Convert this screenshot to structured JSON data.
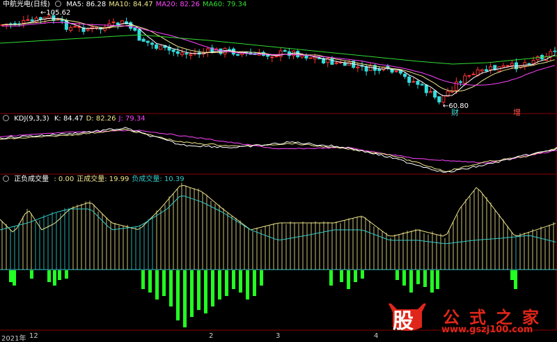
{
  "main": {
    "title": "中航光电(日线)",
    "indicators": [
      {
        "label": "MA5: 86.28",
        "color": "#ffffff"
      },
      {
        "label": "MA10: 84.47",
        "color": "#f0e68c"
      },
      {
        "label": "MA20: 82.26",
        "color": "#ff44ff"
      },
      {
        "label": "MA60: 79.34",
        "color": "#33dd33"
      }
    ],
    "high_label": "105.62",
    "low_label": "60.80",
    "tags": [
      "财",
      "增"
    ]
  },
  "kdj": {
    "title": "KDJ(9,3,3)",
    "indicators": [
      {
        "label": "K: 84.47",
        "color": "#ffffff"
      },
      {
        "label": "D: 82.26",
        "color": "#f0e68c"
      },
      {
        "label": "J: 79.34",
        "color": "#ff44ff"
      }
    ]
  },
  "sub": {
    "title": "正负成交量",
    "indicators": [
      {
        "label": ": 0.00",
        "color": "#f0e68c"
      },
      {
        "label": "正成交量: 19.99",
        "color": "#f0e68c"
      },
      {
        "label": "负成交量: 10.39",
        "color": "#33cccc"
      }
    ]
  },
  "xaxis": {
    "labels": [
      "2021年",
      "12",
      "2",
      "3",
      "4"
    ]
  },
  "watermark": {
    "logo": "股",
    "site_cn": "公式之家",
    "site_url": "www.gszj100.com"
  },
  "colors": {
    "up": "#ff3333",
    "down": "#33dddd",
    "border": "#8b0000",
    "neg_bar": "#22ff22"
  },
  "chart_data": {
    "type": "candlestick",
    "title": "中航光电(日线)",
    "high": 105.62,
    "low": 60.8,
    "ma": {
      "MA5": 86.28,
      "MA10": 84.47,
      "MA20": 82.26,
      "MA60": 79.34
    },
    "kdj": {
      "K": 84.47,
      "D": 82.26,
      "J": 79.34
    },
    "volume": {
      "base": 0.0,
      "positive": 19.99,
      "negative": 10.39
    }
  }
}
